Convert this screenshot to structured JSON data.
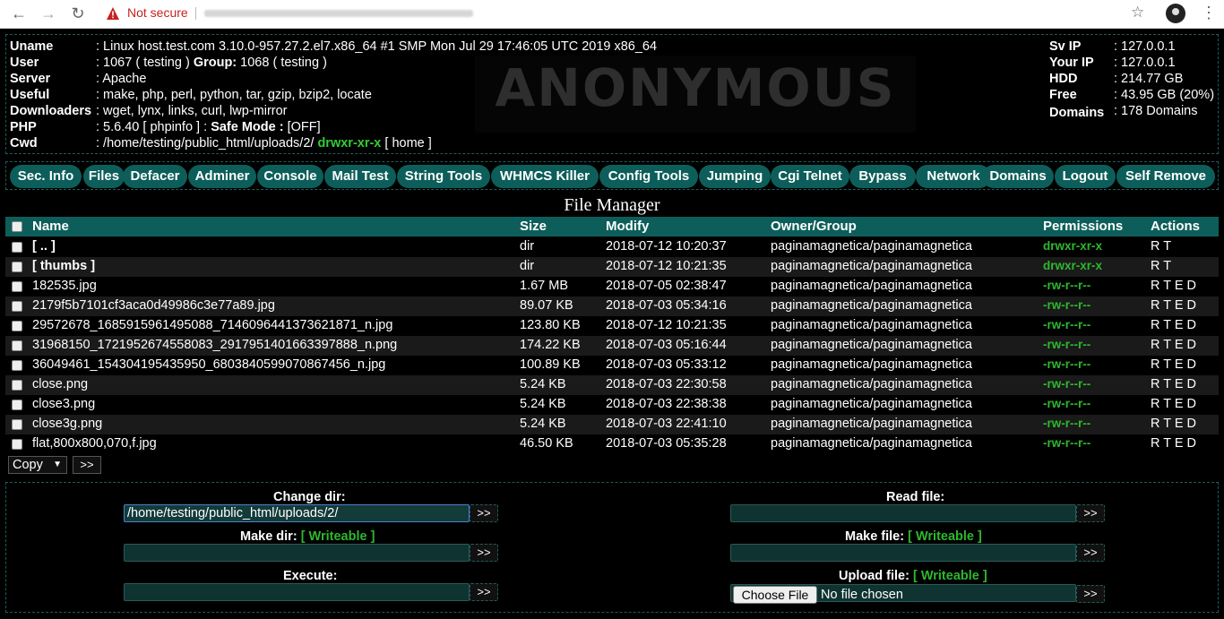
{
  "browser": {
    "security_label": "Not secure"
  },
  "info": {
    "rows": [
      {
        "label": "Uname",
        "value": ": Linux host.test.com 3.10.0-957.27.2.el7.x86_64 #1 SMP Mon Jul 29 17:46:05 UTC 2019 x86_64"
      },
      {
        "label": "User",
        "value": ": 1067 ( testing )",
        "extra_label": "Group:",
        "extra_value": "1068 ( testing )"
      },
      {
        "label": "Server",
        "value": ": Apache"
      },
      {
        "label": "Useful",
        "value": ": make, php, perl, python, tar, gzip, bzip2, locate"
      },
      {
        "label": "Downloaders",
        "value": ": wget, lynx, links, curl, lwp-mirror"
      },
      {
        "label": "PHP",
        "value": ": 5.6.40 [ phpinfo ] :",
        "extra_label": "Safe Mode :",
        "extra_value": "[OFF]"
      },
      {
        "label": "Cwd",
        "value": ": /home/testing/public_html/uploads/2/",
        "perm": "drwxr-xr-x",
        "tail": "[ home ]"
      }
    ],
    "right_rows": [
      {
        "label": "Sv IP",
        "value": ": 127.0.0.1"
      },
      {
        "label": "Your IP",
        "value": ": 127.0.0.1"
      },
      {
        "label": "HDD",
        "value": ": 214.77 GB"
      },
      {
        "label": "Free",
        "value": ": 43.95 GB (20%)"
      },
      {
        "label": "Domains",
        "value": ": 178 Domains"
      }
    ],
    "logo_text": "ANONYMOUS"
  },
  "menu": [
    "Sec. Info",
    "Files",
    "Defacer",
    "Adminer",
    "Console",
    "Mail Test",
    "String Tools",
    "WHMCS Killer",
    "Config Tools",
    "Jumping",
    "Cgi Telnet",
    "Bypass",
    "Network",
    "Domains",
    "Logout",
    "Self Remove"
  ],
  "file_manager": {
    "title": "File Manager",
    "columns": {
      "name": "Name",
      "size": "Size",
      "modify": "Modify",
      "owner": "Owner/Group",
      "permissions": "Permissions",
      "actions": "Actions"
    },
    "rows": [
      {
        "name": "[ .. ]",
        "size": "dir",
        "modify": "2018-07-12 10:20:37",
        "owner": "paginamagnetica/paginamagnetica",
        "perm": "drwxr-xr-x",
        "actions": "R T",
        "dir": true
      },
      {
        "name": "[ thumbs ]",
        "size": "dir",
        "modify": "2018-07-12 10:21:35",
        "owner": "paginamagnetica/paginamagnetica",
        "perm": "drwxr-xr-x",
        "actions": "R T",
        "dir": true
      },
      {
        "name": "182535.jpg",
        "size": "1.67 MB",
        "modify": "2018-07-05 02:38:47",
        "owner": "paginamagnetica/paginamagnetica",
        "perm": "-rw-r--r--",
        "actions": "R T E D"
      },
      {
        "name": "2179f5b7101cf3aca0d49986c3e77a89.jpg",
        "size": "89.07 KB",
        "modify": "2018-07-03 05:34:16",
        "owner": "paginamagnetica/paginamagnetica",
        "perm": "-rw-r--r--",
        "actions": "R T E D"
      },
      {
        "name": "29572678_1685915961495088_7146096441373621871_n.jpg",
        "size": "123.80 KB",
        "modify": "2018-07-12 10:21:35",
        "owner": "paginamagnetica/paginamagnetica",
        "perm": "-rw-r--r--",
        "actions": "R T E D"
      },
      {
        "name": "31968150_1721952674558083_2917951401663397888_n.png",
        "size": "174.22 KB",
        "modify": "2018-07-03 05:16:44",
        "owner": "paginamagnetica/paginamagnetica",
        "perm": "-rw-r--r--",
        "actions": "R T E D"
      },
      {
        "name": "36049461_154304195435950_6803840599070867456_n.jpg",
        "size": "100.89 KB",
        "modify": "2018-07-03 05:33:12",
        "owner": "paginamagnetica/paginamagnetica",
        "perm": "-rw-r--r--",
        "actions": "R T E D"
      },
      {
        "name": "close.png",
        "size": "5.24 KB",
        "modify": "2018-07-03 22:30:58",
        "owner": "paginamagnetica/paginamagnetica",
        "perm": "-rw-r--r--",
        "actions": "R T E D"
      },
      {
        "name": "close3.png",
        "size": "5.24 KB",
        "modify": "2018-07-03 22:38:38",
        "owner": "paginamagnetica/paginamagnetica",
        "perm": "-rw-r--r--",
        "actions": "R T E D"
      },
      {
        "name": "close3g.png",
        "size": "5.24 KB",
        "modify": "2018-07-03 22:41:10",
        "owner": "paginamagnetica/paginamagnetica",
        "perm": "-rw-r--r--",
        "actions": "R T E D"
      },
      {
        "name": "flat,800x800,070,f.jpg",
        "size": "46.50 KB",
        "modify": "2018-07-03 05:35:28",
        "owner": "paginamagnetica/paginamagnetica",
        "perm": "-rw-r--r--",
        "actions": "R T E D"
      }
    ],
    "action_select": "Copy",
    "go_label": ">>"
  },
  "tools": {
    "change_dir_label": "Change dir:",
    "change_dir_value": "/home/testing/public_html/uploads/2/",
    "make_dir_label": "Make dir:",
    "make_dir_status": "[ Writeable ]",
    "execute_label": "Execute:",
    "read_file_label": "Read file:",
    "make_file_label": "Make file:",
    "make_file_status": "[ Writeable ]",
    "upload_file_label": "Upload file:",
    "upload_file_status": "[ Writeable ]",
    "choose_file_label": "Choose File",
    "no_file_label": "No file chosen",
    "go_label": ">>"
  },
  "colors": {
    "accent": "#0d5e5a",
    "permission_green": "#2db82d",
    "background": "#000000"
  }
}
